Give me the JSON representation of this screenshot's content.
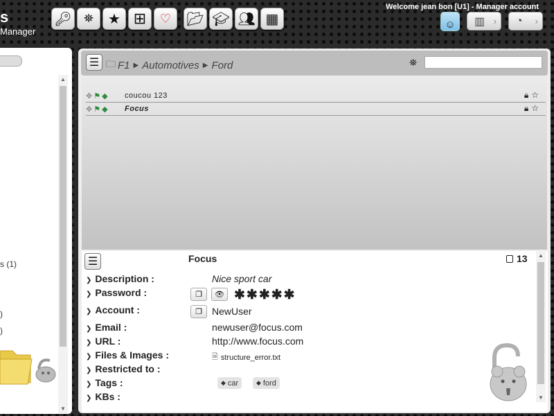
{
  "app": {
    "name_fragment": "s",
    "subtitle_fragment": "Manager"
  },
  "toolbar": {
    "buttons": [
      {
        "name": "key-icon",
        "glyph": "⚿"
      },
      {
        "name": "binoculars-icon",
        "glyph": "⊗"
      },
      {
        "name": "star-icon",
        "glyph": "★"
      },
      {
        "name": "signpost-icon",
        "glyph": "⊞"
      },
      {
        "name": "lightbulb-icon",
        "glyph": "♀"
      },
      {
        "name": "folder-open-icon",
        "glyph": "⊏"
      },
      {
        "name": "graduation-cap-icon",
        "glyph": "⌂"
      },
      {
        "name": "users-icon",
        "glyph": "♟"
      },
      {
        "name": "cubes-icon",
        "glyph": "▦"
      }
    ]
  },
  "user": {
    "welcome": "Welcome jean bon [U1] - Manager account"
  },
  "nav": {
    "map_icon": "map-icon",
    "dashboard_icon": "dashboard-icon"
  },
  "left_tree": {
    "items": [
      {
        "text": "s",
        "count": "(1)"
      },
      {
        "text": ")"
      },
      {
        "text": ")"
      }
    ]
  },
  "breadcrumb": {
    "items": [
      "F1",
      "Automotives",
      "Ford"
    ]
  },
  "items": [
    {
      "label": "coucou 123",
      "italic_bold": false
    },
    {
      "label": "Focus",
      "italic_bold": true
    }
  ],
  "detail": {
    "title": "Focus",
    "count": "13",
    "labels": {
      "description": "Description :",
      "password": "Password :",
      "account": "Account :",
      "email": "Email :",
      "url": "URL :",
      "files": "Files & Images :",
      "restricted": "Restricted to :",
      "tags": "Tags :",
      "kbs": "KBs :"
    },
    "description": "Nice sport car",
    "password_mask": "✱✱✱✱✱",
    "account": "NewUser",
    "email": "newuser@focus.com",
    "url": "http://www.focus.com",
    "file": "structure_error.txt",
    "tags": [
      "car",
      "ford"
    ]
  },
  "colors": {
    "accent_green": "#2e8b3d",
    "header_gray": "#bdbdbd"
  }
}
